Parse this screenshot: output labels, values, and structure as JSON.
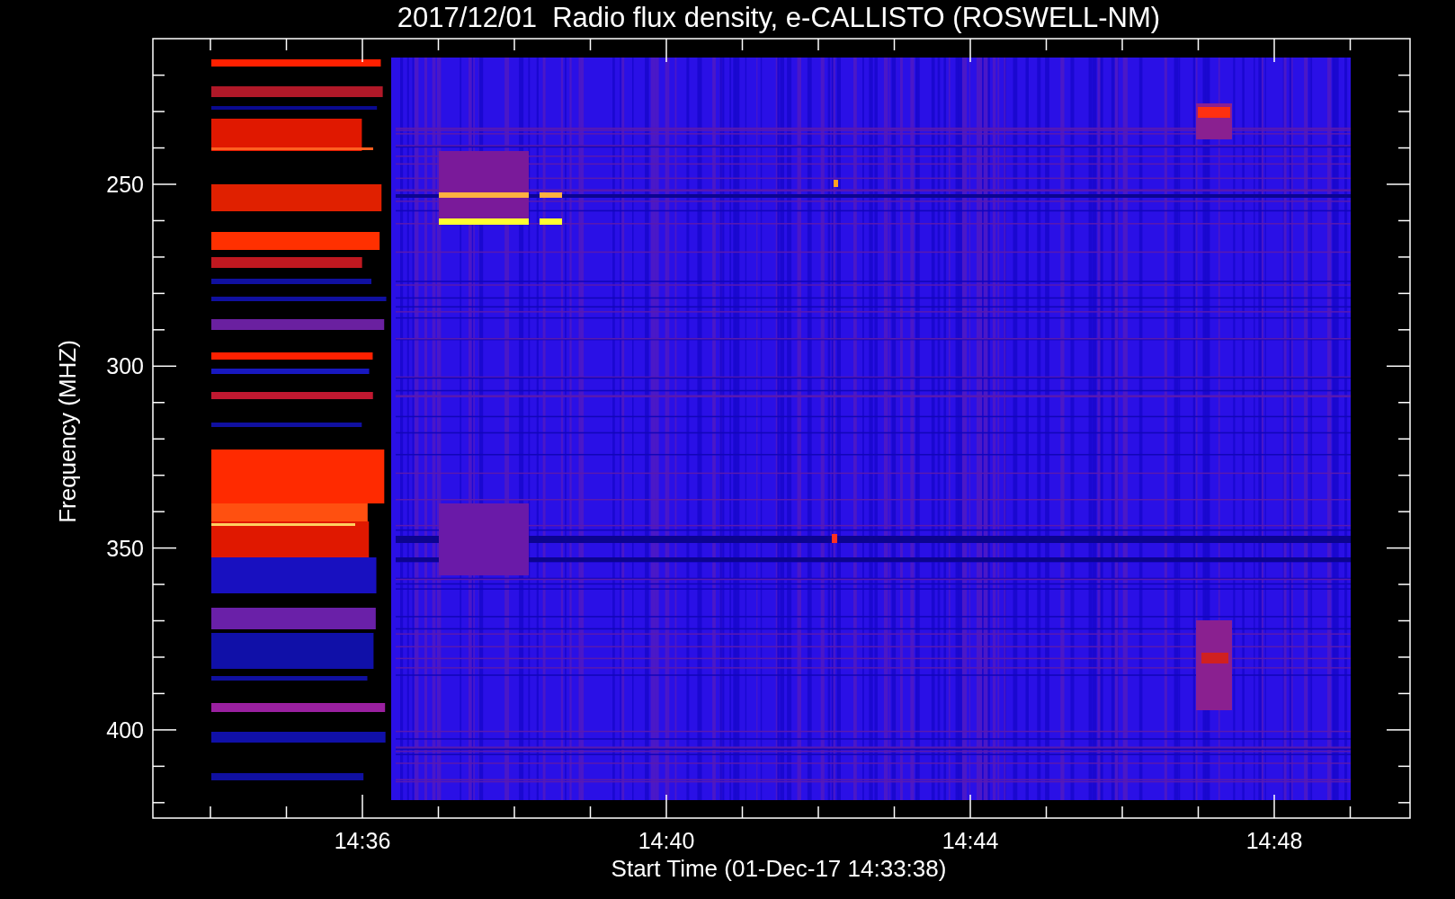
{
  "title": "2017/12/01  Radio flux density, e-CALLISTO (ROSWELL-NM)",
  "y_axis": {
    "label": "Frequency (MHZ)",
    "ticks": [
      "250",
      "300",
      "350",
      "400"
    ]
  },
  "x_axis": {
    "label": "Start Time (01-Dec-17 14:33:38)",
    "ticks": [
      "14:36",
      "14:40",
      "14:44",
      "14:48"
    ]
  }
}
